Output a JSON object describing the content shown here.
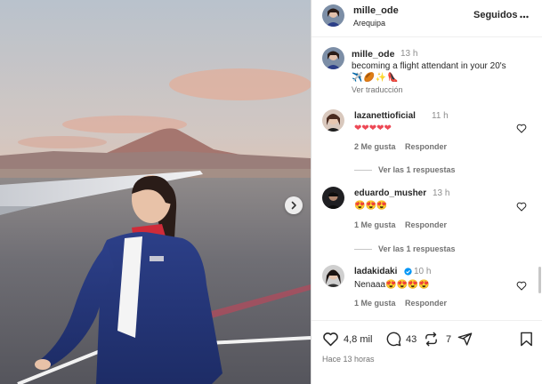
{
  "post": {
    "username": "mille_ode",
    "location": "Arequipa",
    "follow_label": "Seguidos"
  },
  "caption": {
    "username": "mille_ode",
    "time": "13 h",
    "text": "becoming a flight attendant in your 20's",
    "emoji": "✈️🏉✨👠",
    "translate_label": "Ver traducción"
  },
  "comments": [
    {
      "username": "lazanettioficial",
      "time": "11 h",
      "text": "❤❤❤❤❤",
      "likes": "2 Me gusta",
      "reply_label": "Responder",
      "view_replies": "Ver las 1 respuestas"
    },
    {
      "username": "eduardo_musher",
      "time": "13 h",
      "text": "😍😍😍",
      "likes": "1 Me gusta",
      "reply_label": "Responder",
      "view_replies": "Ver las 1 respuestas"
    },
    {
      "username": "ladakidaki",
      "time": "10 h",
      "verified": true,
      "text": "Nenaaa😍😍😍😍",
      "likes": "1 Me gusta",
      "reply_label": "Responder"
    }
  ],
  "actions": {
    "likes_count": "4,8 mil",
    "comments_count": "43",
    "reposts_count": "7",
    "posted_ago": "Hace 13 horas"
  },
  "icons": {
    "like": "heart-icon",
    "comment": "comment-icon",
    "repost": "repost-icon",
    "share": "share-icon",
    "save": "bookmark-icon",
    "next": "chevron-right-icon",
    "verified": "verified-badge-icon"
  },
  "colors": {
    "verified": "#0095f6",
    "heart_red": "#ed4956",
    "text_primary": "#262626",
    "text_secondary": "#737373"
  }
}
